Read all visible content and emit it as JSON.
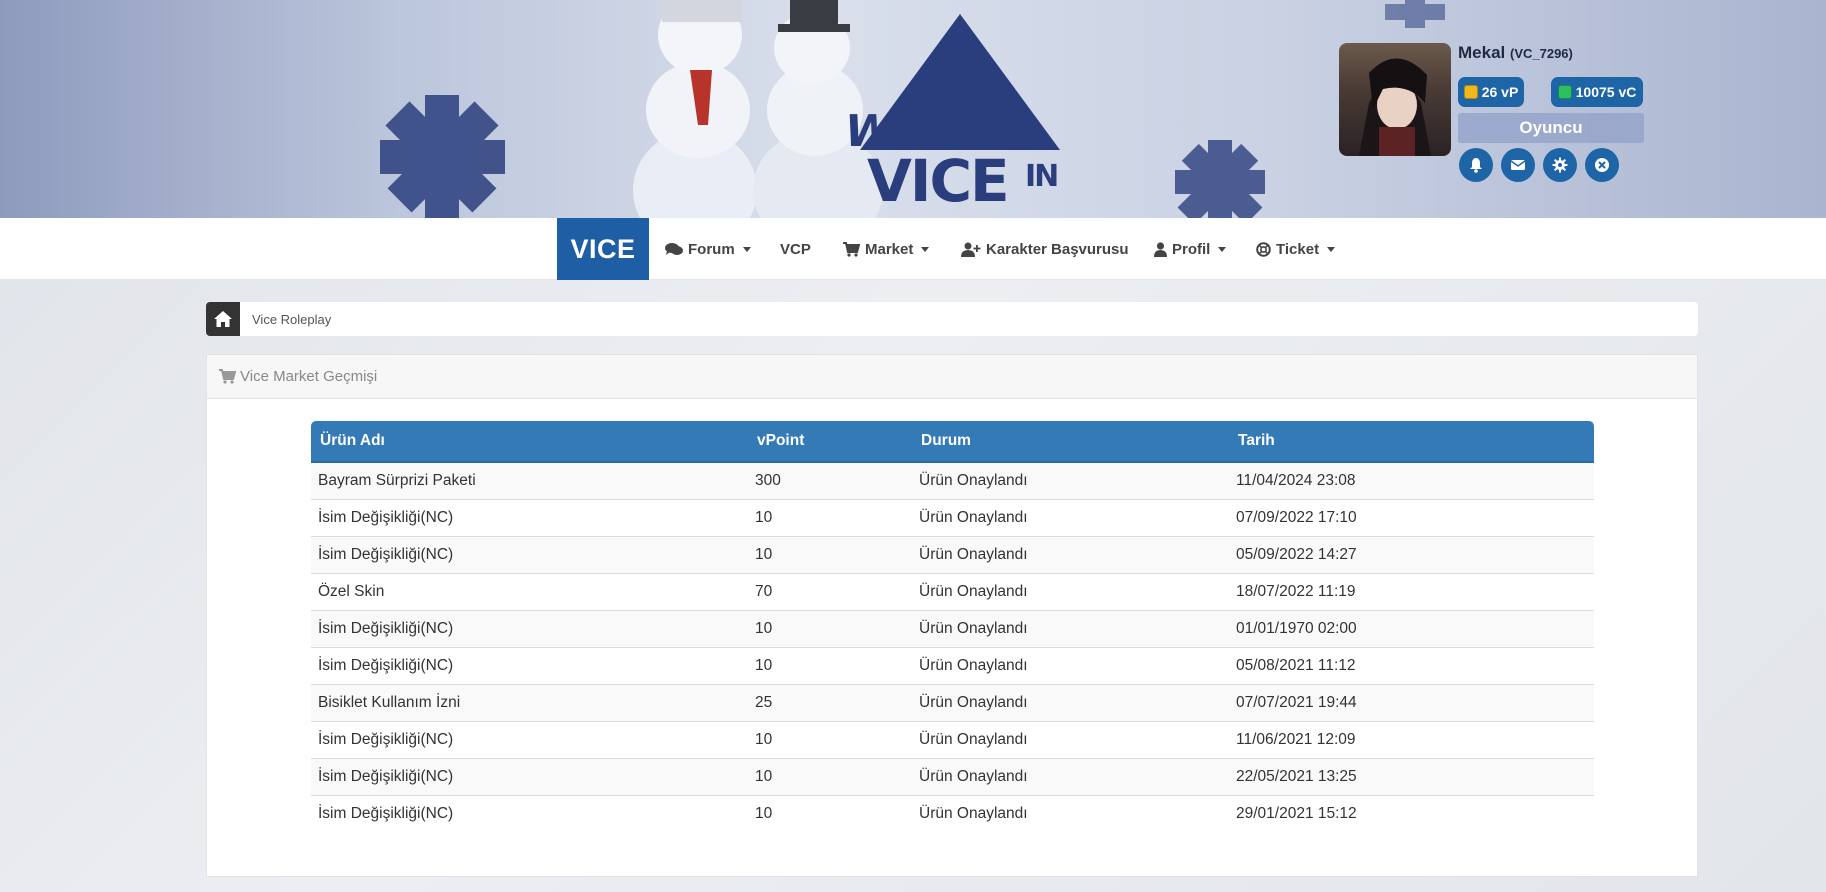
{
  "colors": {
    "primary": "#1e5ea4",
    "table_header": "#337ab7",
    "banner": "#2a3d7c"
  },
  "logo": {
    "line1": "WINTER",
    "line2": "VICE",
    "line3": "IN"
  },
  "user": {
    "name": "Mekal",
    "id": "(VC_7296)",
    "vp": "26 vP",
    "vc": "10075 vC",
    "role": "Oyuncu",
    "icons": [
      "bell-icon",
      "envelope-icon",
      "gear-icon",
      "close-icon"
    ]
  },
  "nav": {
    "brand": "VICE",
    "items": [
      {
        "label": "Forum",
        "icon": "comments-icon",
        "dropdown": true
      },
      {
        "label": "VCP",
        "icon": "",
        "dropdown": false
      },
      {
        "label": "Market",
        "icon": "cart-icon",
        "dropdown": true
      },
      {
        "label": "Karakter Başvurusu",
        "icon": "user-plus-icon",
        "dropdown": false
      },
      {
        "label": "Profil",
        "icon": "user-icon",
        "dropdown": true
      },
      {
        "label": "Ticket",
        "icon": "lifering-icon",
        "dropdown": true
      }
    ]
  },
  "breadcrumb": {
    "label": "Vice Roleplay"
  },
  "panel": {
    "title": "Vice Market Geçmişi"
  },
  "table": {
    "headers": [
      "Ürün Adı",
      "vPoint",
      "Durum",
      "Tarih"
    ],
    "rows": [
      [
        "Bayram Sürprizi Paketi",
        "300",
        "Ürün Onaylandı",
        "11/04/2024 23:08"
      ],
      [
        "İsim Değişikliği(NC)",
        "10",
        "Ürün Onaylandı",
        "07/09/2022 17:10"
      ],
      [
        "İsim Değişikliği(NC)",
        "10",
        "Ürün Onaylandı",
        "05/09/2022 14:27"
      ],
      [
        "Özel Skin",
        "70",
        "Ürün Onaylandı",
        "18/07/2022 11:19"
      ],
      [
        "İsim Değişikliği(NC)",
        "10",
        "Ürün Onaylandı",
        "01/01/1970 02:00"
      ],
      [
        "İsim Değişikliği(NC)",
        "10",
        "Ürün Onaylandı",
        "05/08/2021 11:12"
      ],
      [
        "Bisiklet Kullanım İzni",
        "25",
        "Ürün Onaylandı",
        "07/07/2021 19:44"
      ],
      [
        "İsim Değişikliği(NC)",
        "10",
        "Ürün Onaylandı",
        "11/06/2021 12:09"
      ],
      [
        "İsim Değişikliği(NC)",
        "10",
        "Ürün Onaylandı",
        "22/05/2021 13:25"
      ],
      [
        "İsim Değişikliği(NC)",
        "10",
        "Ürün Onaylandı",
        "29/01/2021 15:12"
      ]
    ]
  }
}
